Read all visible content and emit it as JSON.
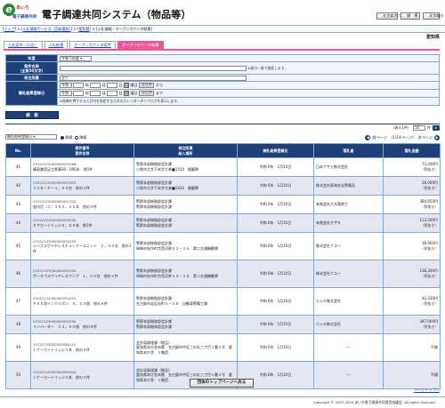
{
  "logo": {
    "line1": "あいち",
    "line2": "電子調達共同"
  },
  "header": {
    "title": "電子調達共同システム（物品等）",
    "buttons": [
      "文字拡大 ▽",
      "標　準",
      "文字縮小"
    ]
  },
  "breadcrumb": [
    "トップ",
    "入札情報サービス（団体選択）",
    "愛知県",
    "入札情報・オープンカウンタ結果"
  ],
  "prefecture": "愛知県",
  "tabs": [
    "入札案件（公告）",
    "入札結果",
    "オープンカウンタ案件",
    "オープンカウンタ結果"
  ],
  "form": {
    "year_label": "年度",
    "year_value": "令和 5年度",
    "name_label": "案件名称\n（全角50文字）",
    "name_note": "※部分一致で検索します。",
    "org_label": "発注所属",
    "org_value": "全て",
    "date_label": "開札結果登録日",
    "era": "令和",
    "year_unit": "年",
    "month_unit": "月",
    "day_unit": "日",
    "cal_symbol": "月",
    "weekday_unit": "曜日",
    "clear_label": "クリア",
    "from_label": "から",
    "to_label": "まで",
    "date_note": "※画像を押下すると日付を指定するためのカレンダーダイアログを表示します。"
  },
  "search_button": "検　索",
  "results": {
    "count_text": "（表示1件）",
    "per_page": "50",
    "per_page_unit": "件",
    "sort_value": "開札結果登録日",
    "asc_label": "昇順",
    "desc_label": "降順",
    "prev_label": "前ページ",
    "page_info": "（1/14ページ）",
    "next_label": "次ページ",
    "columns": [
      "No.",
      "案件番号\n案件名称",
      "発注所属\n納入場所",
      "開札結果登録日",
      "落札者",
      "落札金額"
    ],
    "rows": [
      {
        "no": "41",
        "num": "23122223000000051066",
        "name": "晴雨兼用足立懸濁30，000本　他1件",
        "org": "警察本部総務部会計課",
        "place": "小牧市大字下末字大林■1414　掘翻隊",
        "date": "令和 6年　1月10日",
        "winner": "日本アサヒ株式会社",
        "amount": "73,000円",
        "tax": "（税抜き）"
      },
      {
        "no": "42",
        "num": "23122223000000051303",
        "name": "リミキーチー１，００台　他の３件",
        "org": "警察本部総務部会計課",
        "place": "小牧市大字下末字大林■1414　掘翻隊",
        "date": "令和 6年　1月10日",
        "winner": "株式会社東海文化警備品",
        "amount": "28,000円",
        "tax": "（税抜き）"
      },
      {
        "no": "43",
        "num": "23122223000000051304",
        "name": "蛍光灯（１）３５０，００本　他の３件",
        "org": "警察本部総務部会計課",
        "place": "警察本部総務部会計課",
        "date": "令和 6年　1月10日",
        "winner": "有限会社大光電商工",
        "amount": "384,650円",
        "tax": "（税抜き）"
      },
      {
        "no": "44",
        "num": "23122423000000054220",
        "name": "Ｅアカートリッジ５，００本　他1件",
        "org": "警察本部総務部会計課",
        "place": "警察本部総務部会計課",
        "date": "令和 6年　1月10日",
        "winner": "有限会社オザキ",
        "amount": "113,500円",
        "tax": "（税抜き）"
      },
      {
        "no": "45",
        "num": "23122123000000052293",
        "name": "シングルワイヤレスチューナーユニット　２，００台　他の1件",
        "org": "警察本部総務部会計課",
        "place": "岡崎市矢作町字西河原３３－１０　第二交通機動隊",
        "date": "令和 6年　1月10日",
        "winner": "株式会社ナユー",
        "amount": "38,900円",
        "tax": "（税抜き）"
      },
      {
        "no": "46",
        "num": "23122123000000052292",
        "name": "ポータブルワイヤレスアンプ　１，００台　他の２件",
        "org": "警察本部総務部会計課",
        "place": "岡崎市矢作町字西河原３３－１０　第二交通機動隊",
        "date": "令和 6年　1月10日",
        "winner": "株式会社ナユー",
        "amount": "138,300円",
        "tax": "（税抜き）"
      },
      {
        "no": "47",
        "num": "23122123000000052291",
        "name": "ＦＡＸ用インクリボン　５，００個　他の８件",
        "org": "警察本部総務部会計課",
        "place": "名古屋市北区松町１－１８　自動車警備工場",
        "date": "令和 6年　1月10日",
        "winner": "ニシキ株式会社",
        "amount": "42,330円",
        "tax": "（税抜き）"
      },
      {
        "no": "48",
        "num": "23122123000000052290",
        "name": "インバーター　１２，００個　他の８件",
        "org": "警察本部総務部会計課",
        "place": "警察本部総務部会計課",
        "date": "令和 6年　1月10日",
        "winner": "ニシキ株式会社",
        "amount": "347,000円",
        "tax": "（税抜き）"
      },
      {
        "no": "49",
        "num": "23122723000000060115",
        "name": "トナーカートリッジ１本　他の４件",
        "org": "会計局調達課（物品）",
        "place": "愛知県本庁舎本館　名古屋市中区三の丸三丁目１番２号　愛知県本庁舎　１階西",
        "date": "令和 6年　1月10日",
        "winner": "―",
        "amount": "不調",
        "tax": ""
      },
      {
        "no": "50",
        "num": "23122123000000064004",
        "name": "トナーカートリッジ３本　他の３件",
        "org": "会計局調達課（物品）",
        "place": "愛知県本庁舎本館　名古屋市中区三の丸三丁目１番２号　愛知県本庁舎　１階西",
        "date": "令和 6年　1月10日",
        "winner": "―",
        "amount": "不調",
        "tax": ""
      }
    ]
  },
  "back_button": "団体のトップページへ戻る",
  "top_link": "ページトップへ",
  "footer": "Copyright © 2007-2024 あいち電子調達共同運営協議会. All rights reserved."
}
